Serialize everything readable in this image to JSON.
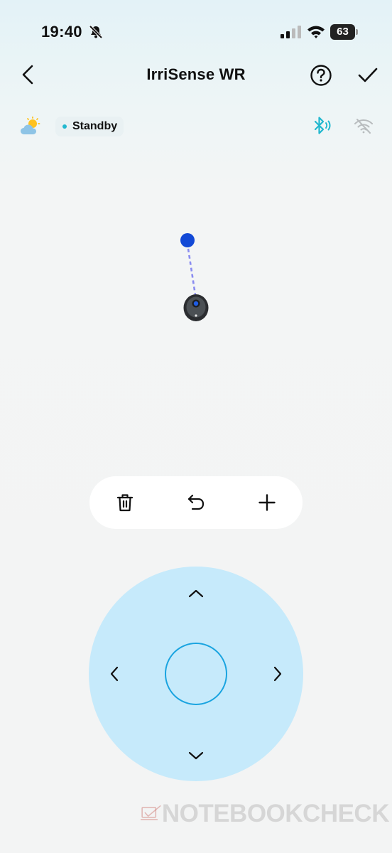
{
  "status_bar": {
    "time": "19:40",
    "battery_level": "63",
    "icons": [
      "bell-slash-icon",
      "cellular-signal-icon",
      "wifi-icon",
      "battery-icon"
    ]
  },
  "header": {
    "title": "IrriSense WR",
    "back_icon": "chevron-left-icon",
    "help_icon": "help-circle-icon",
    "confirm_icon": "checkmark-icon"
  },
  "device_status": {
    "weather_icon": "partly-cloudy-icon",
    "state": "Standby",
    "state_color": "#22b8cf",
    "bluetooth_icon": "bluetooth-connected-icon",
    "bluetooth_color": "#22b8cf",
    "wifi_icon": "wifi-off-icon"
  },
  "map": {
    "target_point_color": "#1249d6",
    "path_color": "#8a8cf0",
    "robot_icon": "robot-mower-icon"
  },
  "toolbar": {
    "items": [
      "delete-icon",
      "undo-icon",
      "add-icon"
    ]
  },
  "joystick": {
    "pad_color": "#c6eafb",
    "center_ring_color": "#1aa4e0",
    "directions": [
      "up",
      "down",
      "left",
      "right"
    ]
  },
  "watermark": {
    "text": "NOTEBOOKCHECK"
  }
}
